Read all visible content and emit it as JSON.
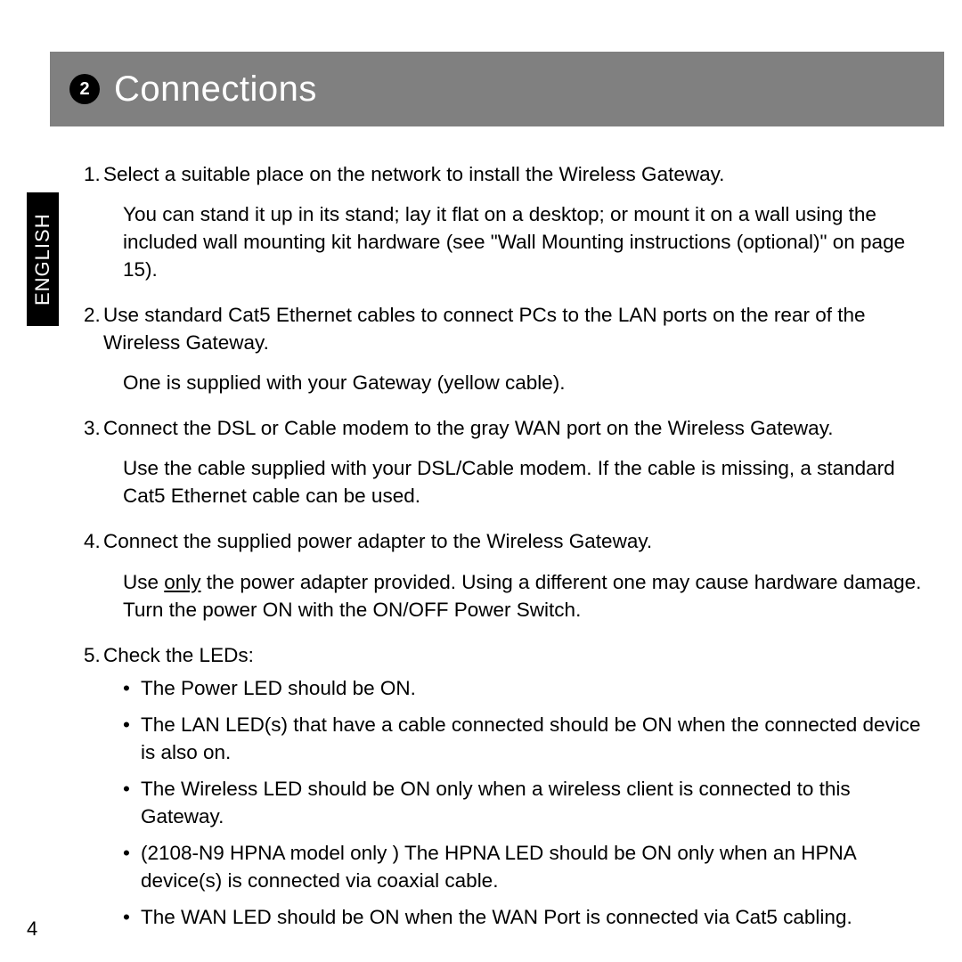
{
  "chapter": {
    "number": "2",
    "title": "Connections"
  },
  "side_tab": "ENGLISH",
  "page_number": "4",
  "steps": {
    "s1": {
      "num": "1.",
      "text": "Select a suitable place on the network to install the Wireless Gateway.",
      "sub": "You can stand it up in its stand; lay it flat on a desktop; or mount it on a wall using the included wall mounting kit hardware (see \"Wall Mounting instructions (optional)\" on page 15)."
    },
    "s2": {
      "num": "2.",
      "text": "Use standard Cat5 Ethernet cables to connect PCs to the LAN ports on the rear of the Wireless Gateway.",
      "sub": "One is supplied with your Gateway (yellow cable)."
    },
    "s3": {
      "num": "3.",
      "text": "Connect the DSL or Cable modem to the gray WAN port on the Wireless Gate­way.",
      "sub": "Use the cable supplied with your DSL/Cable modem. If the cable is missing, a standard Cat5 Ethernet cable can be used."
    },
    "s4": {
      "num": "4.",
      "text": "Connect the supplied power adapter to the Wireless Gateway.",
      "sub_pre": "Use ",
      "sub_u": "only",
      "sub_post": " the power adapter provided. Using a different one may cause hardware dam­age. Turn the power ON with the ON/OFF Power Switch."
    },
    "s5": {
      "num": "5.",
      "text": "Check the LEDs:",
      "bullets": [
        "The Power LED should be ON.",
        "The LAN LED(s) that have a cable connected should be ON when the connected device is also on.",
        "The Wireless LED should be ON only when a wireless client is connected to this Gateway.",
        "(2108-N9 HPNA model only  ) The HPNA LED should be ON only when an HPNA device(s) is connected via coaxial cable.",
        "The WAN LED should be ON when the WAN Port is connected via Cat5 cabling."
      ]
    }
  }
}
